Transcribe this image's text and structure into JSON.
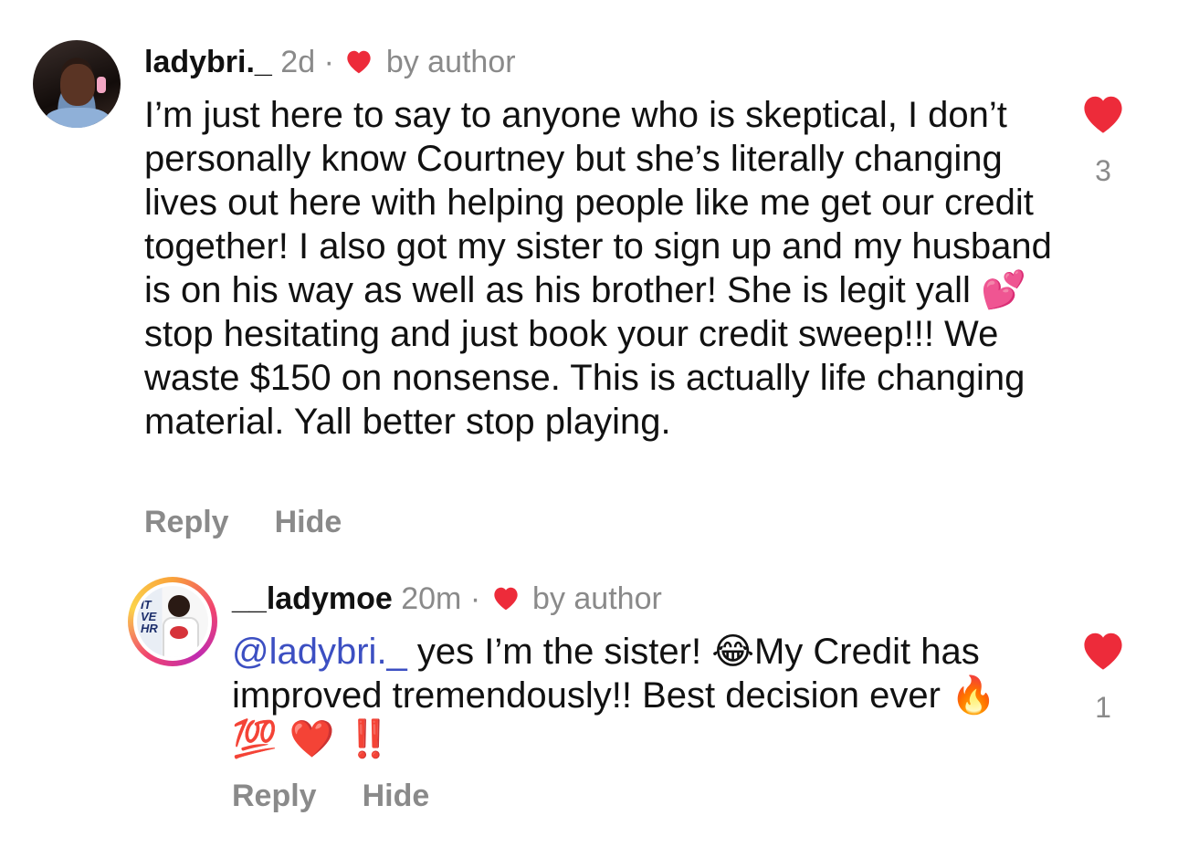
{
  "comments": [
    {
      "username": "ladybri._",
      "time": "2d",
      "separator": "·",
      "badge": "by author",
      "text": "I’m just here to say to anyone who is skeptical, I don’t personally know Courtney but she’s literally changing lives out here with helping people like me get our credit together! I also got my sister to sign up and my husband is on his way as well as his brother! She is legit yall",
      "emoji_1": "💕",
      "text_after": " stop hesitating and just book your credit sweep!!! We waste $150 on nonsense. This is actually life changing material. Yall better stop playing.",
      "reply_label": "Reply",
      "hide_label": "Hide",
      "like_count": "3",
      "like_icon": "heart-filled-icon",
      "heart_color": "#ed2b3a"
    },
    {
      "username": "__ladymoe",
      "time": "20m",
      "separator": "·",
      "badge": "by author",
      "mention": "@ladybri._",
      "text": " yes I’m the sister! ",
      "emoji_1": "😂",
      "text_after": "My Credit has improved tremendously!! Best decision ever ",
      "emoji_tail": "🔥 💯 ❤️ ‼️",
      "reply_label": "Reply",
      "hide_label": "Hide",
      "like_count": "1",
      "like_icon": "heart-filled-icon",
      "heart_color": "#ed2b3a",
      "mention_color": "#3c4fc2"
    }
  ]
}
